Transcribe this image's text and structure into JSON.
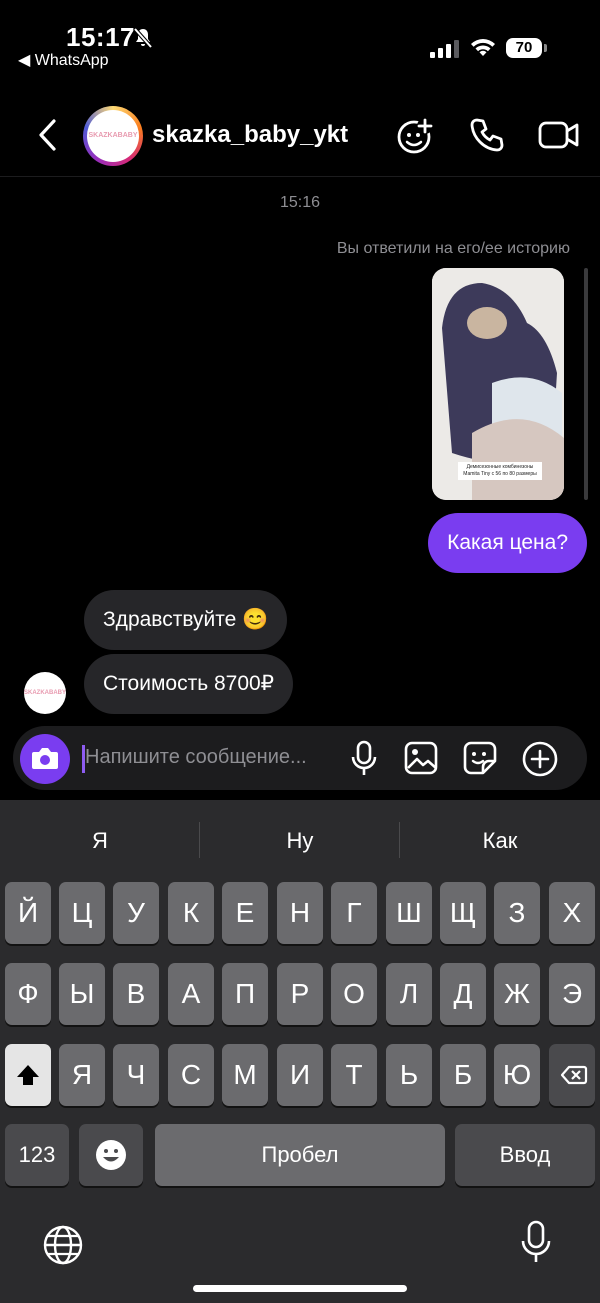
{
  "status_bar": {
    "time": "15:17",
    "back_app": "◀ WhatsApp",
    "battery": "70"
  },
  "header": {
    "username": "skazka_baby_ykt",
    "avatar_text": "SKAZKABABY"
  },
  "chat": {
    "timestamp": "15:16",
    "replied_to_story": "Вы ответили на его/ее историю",
    "story_caption": "Демисезонные комбинезоны Mamita Tiny с 56 по 80 размеры",
    "messages": [
      {
        "from": "me",
        "text": "Какая цена?"
      },
      {
        "from": "them",
        "text": "Здравствуйте 😊"
      },
      {
        "from": "them",
        "text": "Стоимость 8700₽"
      }
    ]
  },
  "composer": {
    "placeholder": "Напишите сообщение..."
  },
  "keyboard": {
    "suggestions": [
      "Я",
      "Ну",
      "Как"
    ],
    "row1": [
      "Й",
      "Ц",
      "У",
      "К",
      "Е",
      "Н",
      "Г",
      "Ш",
      "Щ",
      "З",
      "Х"
    ],
    "row2": [
      "Ф",
      "Ы",
      "В",
      "А",
      "П",
      "Р",
      "О",
      "Л",
      "Д",
      "Ж",
      "Э"
    ],
    "row3": [
      "Я",
      "Ч",
      "С",
      "М",
      "И",
      "Т",
      "Ь",
      "Б",
      "Ю"
    ],
    "numbers_key": "123",
    "space_key": "Пробел",
    "return_key": "Ввод"
  },
  "colors": {
    "accent": "#7a3df0",
    "incoming_bubble": "#262629",
    "background": "#000000"
  }
}
